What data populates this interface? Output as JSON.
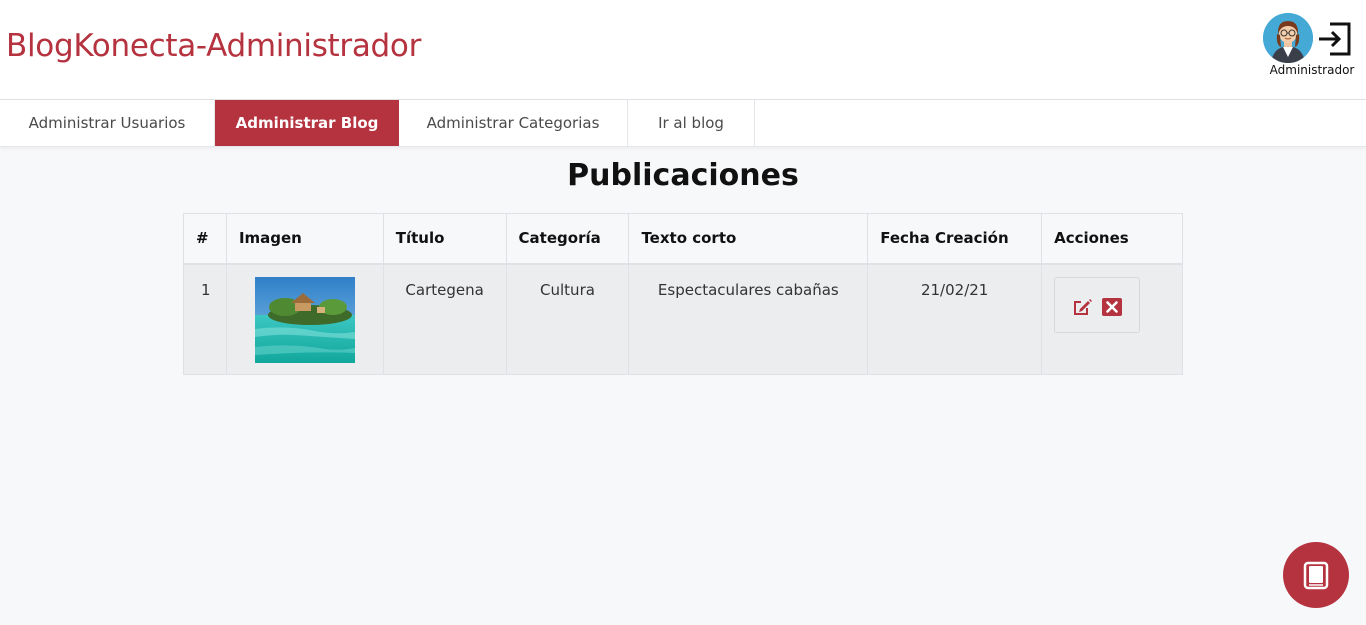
{
  "app": {
    "title": "BlogKonecta-Administrador",
    "brand_color": "#b5323f"
  },
  "user": {
    "name": "Administrador",
    "avatar_icon": "user-avatar-icon",
    "logout_icon": "logout-icon"
  },
  "nav": {
    "tabs": [
      {
        "label": "Administrar Usuarios",
        "active": false
      },
      {
        "label": "Administrar Blog",
        "active": true
      },
      {
        "label": "Administrar Categorias",
        "active": false
      },
      {
        "label": "Ir al blog",
        "active": false
      }
    ]
  },
  "main": {
    "title": "Publicaciones",
    "table": {
      "columns": [
        "#",
        "Imagen",
        "Título",
        "Categoría",
        "Texto corto",
        "Fecha Creación",
        "Acciones"
      ],
      "rows": [
        {
          "num": "1",
          "image_icon": "beach-image",
          "title": "Cartegena",
          "category": "Cultura",
          "short_text": "Espectaculares cabañas",
          "created": "21/02/21",
          "actions": [
            "edit-icon",
            "delete-icon"
          ]
        }
      ]
    }
  },
  "fab": {
    "icon": "book-icon"
  }
}
